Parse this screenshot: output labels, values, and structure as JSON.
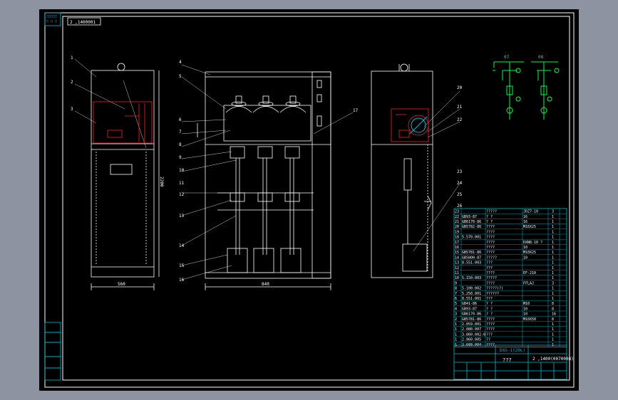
{
  "colors": {
    "background": "#000000",
    "outer_frame": "#8d93a1",
    "lines": "#ffffff",
    "table": "#00bcd4",
    "schematic": "#00ff40",
    "equipment": "#ff2020"
  },
  "title_block": {
    "drawing_number_top": "2 ,1400001",
    "model": "DXG-1(20L)",
    "drawing_number": "2 ,1400(0070008)",
    "name": "???"
  },
  "left_stamp": {
    "top_text": "Small Title Text"
  },
  "dimensions": {
    "left_width": "560",
    "middle_width": "840",
    "left_height": "2200"
  },
  "views": {
    "left_callouts": [
      "1",
      "2",
      "3"
    ],
    "middle_callouts": [
      "4",
      "5",
      "6",
      "7",
      "8",
      "9",
      "10",
      "11",
      "12",
      "13",
      "14",
      "15",
      "16",
      "17"
    ],
    "right_callouts": [
      "20",
      "21",
      "22",
      "23",
      "24",
      "25",
      "26"
    ]
  },
  "schematic": {
    "labels": [
      "07",
      "08"
    ]
  },
  "bom": {
    "rows": [
      {
        "no": "23",
        "code": "",
        "name": "?????",
        "spec": "JDZ7-10",
        "qty": "3"
      },
      {
        "no": "22",
        "code": "GB93-87",
        "name": "? ?",
        "spec": "16",
        "qty": "1"
      },
      {
        "no": "21",
        "code": "GB6170-86",
        "name": "? ?",
        "spec": "16",
        "qty": "1"
      },
      {
        "no": "20",
        "code": "GB5782-86",
        "name": "????",
        "spec": "M16X25",
        "qty": "1"
      },
      {
        "no": "19",
        "code": "",
        "name": "????",
        "spec": "",
        "qty": "1"
      },
      {
        "no": "18",
        "code": "5.570.001",
        "name": "????",
        "spec": "",
        "qty": "1"
      },
      {
        "no": "17",
        "code": "",
        "name": "????",
        "spec": "DXN8-10 ?",
        "qty": "1"
      },
      {
        "no": "16",
        "code": "",
        "name": "????",
        "spec": "10",
        "qty": "1"
      },
      {
        "no": "15",
        "code": "GB5781-86",
        "name": "????",
        "spec": "M10X25",
        "qty": "1"
      },
      {
        "no": "14",
        "code": "GB5800-87",
        "name": "?????",
        "spec": "10",
        "qty": "1"
      },
      {
        "no": "13",
        "code": "8.551.003",
        "name": "???",
        "spec": "",
        "qty": "1"
      },
      {
        "no": "12",
        "code": "",
        "name": "???",
        "spec": "",
        "qty": "1"
      },
      {
        "no": "11",
        "code": "",
        "name": "????",
        "spec": "EF-210",
        "qty": "1"
      },
      {
        "no": "10",
        "code": "5.150.003",
        "name": "?????",
        "spec": "",
        "qty": "1"
      },
      {
        "no": "9",
        "code": "",
        "name": "????",
        "spec": "FFLAJ",
        "qty": "3"
      },
      {
        "no": "8",
        "code": "5.100.002",
        "name": "?????(?)",
        "spec": "",
        "qty": "1"
      },
      {
        "no": "7",
        "code": "5.250.001",
        "name": "??????",
        "spec": "",
        "qty": "1"
      },
      {
        "no": "6",
        "code": "8.551.001",
        "name": "???",
        "spec": "",
        "qty": "1"
      },
      {
        "no": "5",
        "code": "GB41-86",
        "name": "? ?",
        "spec": "M10",
        "qty": "8"
      },
      {
        "no": "4",
        "code": "GB93-87",
        "name": "? ?",
        "spec": "10",
        "qty": "8"
      },
      {
        "no": "3",
        "code": "GB6170-86",
        "name": "? ?",
        "spec": "10",
        "qty": "16"
      },
      {
        "no": "2",
        "code": "GB5781-86",
        "name": "????",
        "spec": "M10X50",
        "qty": "8"
      },
      {
        "no": "1",
        "code": "2.059.001",
        "name": "????",
        "spec": "",
        "qty": "1"
      },
      {
        "no": "1",
        "code": "2.080.007",
        "name": "????",
        "spec": "",
        "qty": "1"
      },
      {
        "no": "1",
        "code": "3.860.002-0",
        "name": "???",
        "spec": "",
        "qty": "1"
      },
      {
        "no": "1",
        "code": "2.860.005",
        "name": "??",
        "spec": "",
        "qty": "1"
      },
      {
        "no": "1",
        "code": "2.680.004",
        "name": "????",
        "spec": "",
        "qty": "1"
      }
    ]
  }
}
